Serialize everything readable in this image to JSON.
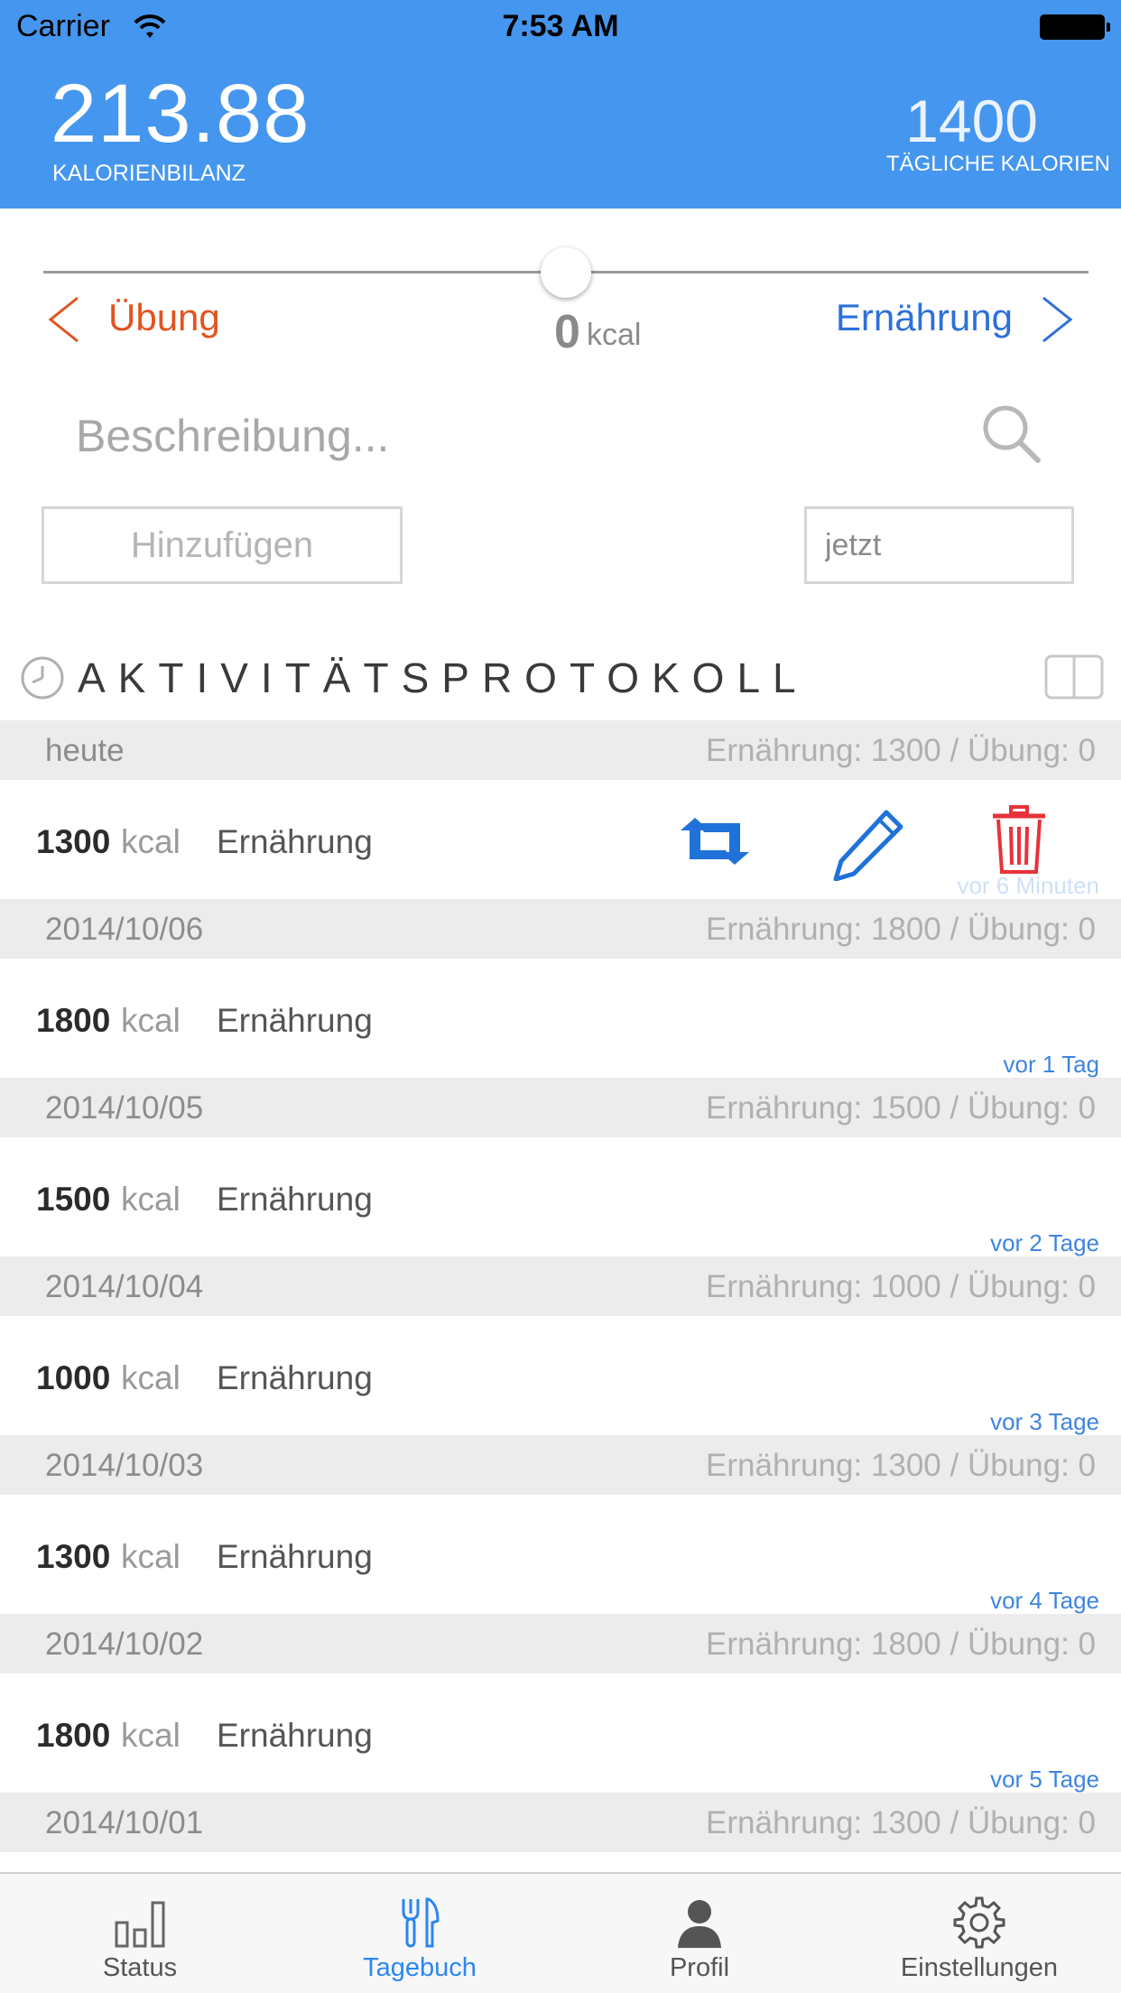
{
  "status_bar": {
    "carrier": "Carrier",
    "time": "7:53 AM"
  },
  "header": {
    "balance_value": "213.88",
    "balance_label": "KALORIENBILANZ",
    "daily_value": "1400",
    "daily_label": "TÄGLICHE KALORIEN"
  },
  "slider": {
    "left_label": "Übung",
    "right_label": "Ernährung",
    "value": "0",
    "unit": "kcal",
    "position": 0.5
  },
  "form": {
    "description_placeholder": "Beschreibung...",
    "add_button": "Hinzufügen",
    "time_value": "jetzt"
  },
  "log": {
    "title": "AKTIVITÄTSPROTOKOLL",
    "days": [
      {
        "date": "heute",
        "summary": "Ernährung: 1300 / Übung: 0",
        "entry": {
          "value": "1300",
          "unit": "kcal",
          "type": "Ernährung",
          "ago": "vor 6 Minuten"
        }
      },
      {
        "date": "2014/10/06",
        "summary": "Ernährung: 1800 / Übung: 0",
        "entry": {
          "value": "1800",
          "unit": "kcal",
          "type": "Ernährung",
          "ago": "vor 1 Tag"
        }
      },
      {
        "date": "2014/10/05",
        "summary": "Ernährung: 1500 / Übung: 0",
        "entry": {
          "value": "1500",
          "unit": "kcal",
          "type": "Ernährung",
          "ago": "vor 2 Tage"
        }
      },
      {
        "date": "2014/10/04",
        "summary": "Ernährung: 1000 / Übung: 0",
        "entry": {
          "value": "1000",
          "unit": "kcal",
          "type": "Ernährung",
          "ago": "vor 3 Tage"
        }
      },
      {
        "date": "2014/10/03",
        "summary": "Ernährung: 1300 / Übung: 0",
        "entry": {
          "value": "1300",
          "unit": "kcal",
          "type": "Ernährung",
          "ago": "vor 4 Tage"
        }
      },
      {
        "date": "2014/10/02",
        "summary": "Ernährung: 1800 / Übung: 0",
        "entry": {
          "value": "1800",
          "unit": "kcal",
          "type": "Ernährung",
          "ago": "vor 5 Tage"
        }
      },
      {
        "date": "2014/10/01",
        "summary": "Ernährung: 1300 / Übung: 0"
      }
    ]
  },
  "tabbar": {
    "items": [
      {
        "label": "Status",
        "icon": "bar-chart-icon"
      },
      {
        "label": "Tagebuch",
        "icon": "fork-knife-icon",
        "active": true
      },
      {
        "label": "Profil",
        "icon": "person-icon"
      },
      {
        "label": "Einstellungen",
        "icon": "gear-icon"
      }
    ]
  },
  "colors": {
    "header": "#4596ee",
    "exercise": "#e0541f",
    "nutrition": "#2e6fd9",
    "delete": "#e8323a",
    "tab_active": "#2b86f2"
  }
}
